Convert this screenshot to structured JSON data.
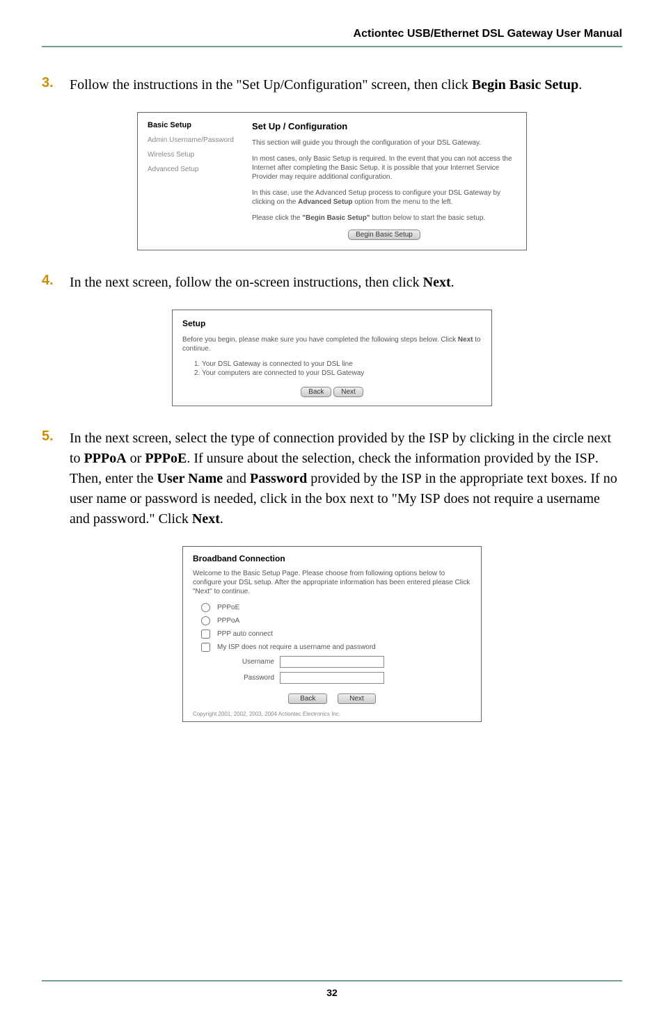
{
  "header": {
    "title": "Actiontec USB/Ethernet DSL Gateway User Manual"
  },
  "steps": {
    "s3": {
      "num": "3.",
      "text_a": "Follow the instructions in the \"Set Up/Configuration\" screen, then click ",
      "text_b": "Begin Basic Setup",
      "text_c": "."
    },
    "s4": {
      "num": "4.",
      "text_a": "In the next screen, follow the on-screen instructions, then click ",
      "text_b": "Next",
      "text_c": "."
    },
    "s5": {
      "num": "5.",
      "text_a": "In the next screen, select the type of connection provided by the ",
      "isp1": "ISP",
      "text_b": " by clicking in the circle next to ",
      "pppoa": "PPPoA",
      "text_or": " or ",
      "pppoe": "PPPoE",
      "text_c": ". If unsure about the selection, check the information provided by the ",
      "isp2": "ISP",
      "text_d": ". Then, enter the ",
      "username": "User Name",
      "text_and": " and ",
      "password": "Password",
      "text_e": " provided by the ",
      "isp3": "ISP",
      "text_f": " in the appropriate text boxes. If no user name or password is needed, click in the box next to \"My ",
      "isp4": "ISP",
      "text_g": " does not require a username and password.\" Click ",
      "next": "Next",
      "text_h": "."
    }
  },
  "ss1": {
    "sidebar": {
      "title": "Basic Setup",
      "item1": "Admin Username/Password",
      "item2": "Wireless Setup",
      "item3": "Advanced Setup"
    },
    "content": {
      "title": "Set Up / Configuration",
      "p1": "This section will guide you through the configuration of your DSL Gateway.",
      "p2": "In most cases, only Basic Setup is required. In the event that you can not access the Internet after completing the Basic Setup, it is possible that your Internet Service Provider may require additional configuration.",
      "p3a": "In this case, use the Advanced Setup process to configure your DSL Gateway by clicking on the ",
      "p3b": "Advanced Setup",
      "p3c": " option from the menu to the left.",
      "p4a": "Please click the ",
      "p4b": "\"Begin Basic Setup\"",
      "p4c": " button below to start the basic setup.",
      "btn": "Begin Basic Setup"
    }
  },
  "ss2": {
    "title": "Setup",
    "p1a": "Before you begin, please make sure you have completed the following steps below. Click ",
    "p1b": "Next",
    "p1c": " to continue.",
    "li1": "Your DSL Gateway is connected to your DSL line",
    "li2": "Your computers are connected to your DSL Gateway",
    "btn_back": "Back",
    "btn_next": "Next"
  },
  "ss3": {
    "title": "Broadband Connection",
    "intro": "Welcome to the Basic Setup Page. Please choose from following options below to configure your DSL setup. After the appropriate information has been entered please Click \"Next\" to continue.",
    "opt1": "PPPoE",
    "opt2": "PPPoA",
    "opt3": "PPP auto connect",
    "opt4": "My ISP does not require a username and password",
    "field_user": "Username",
    "field_pass": "Password",
    "btn_back": "Back",
    "btn_next": "Next",
    "copyright": "Copyright 2001, 2002, 2003, 2004 Actiontec Electronics Inc."
  },
  "footer": {
    "page_num": "32"
  },
  "chart_data": {
    "type": "table",
    "note": "This page is a user-manual document page; no quantitative chart present."
  }
}
